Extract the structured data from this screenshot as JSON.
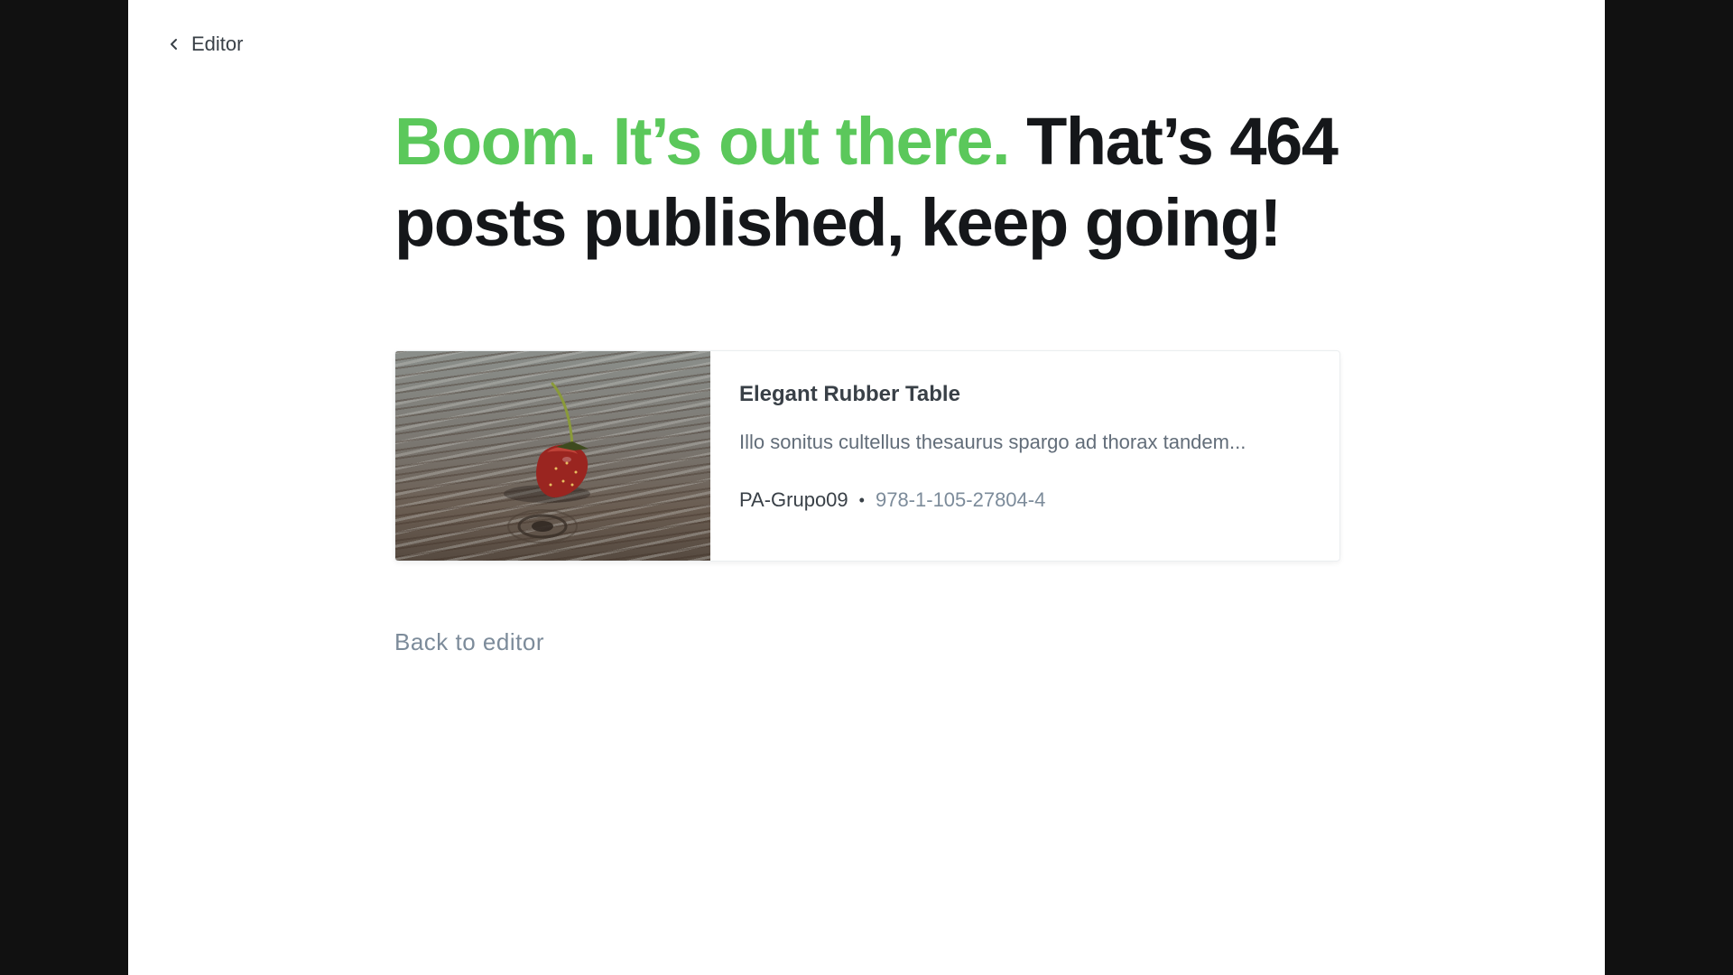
{
  "nav": {
    "back_label": "Editor"
  },
  "headline": {
    "accent": "Boom. It’s out there.",
    "rest": " That’s 464 posts published, keep going!"
  },
  "post_card": {
    "title": "Elegant Rubber Table",
    "excerpt": "Illo sonitus cultellus thesaurus spargo ad thorax tandem...",
    "author": "PA-Grupo09",
    "separator": "•",
    "isbn": "978-1-105-27804-4",
    "image": "strawberry-on-wood-photo"
  },
  "footer": {
    "back_link": "Back to editor"
  },
  "colors": {
    "accent": "#5bc85b",
    "text": "#15171a",
    "muted": "#7c8b9a",
    "frame": "#111111"
  }
}
